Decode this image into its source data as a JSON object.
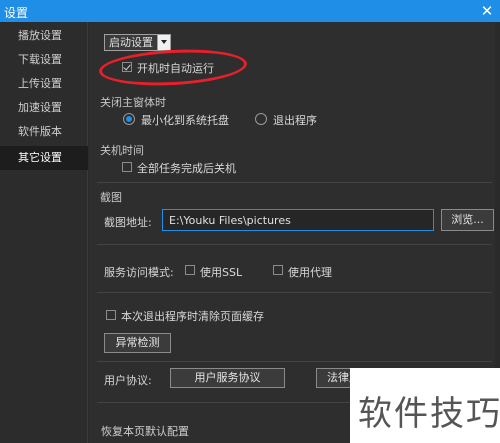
{
  "window": {
    "title": "设置",
    "close_icon": "close-icon"
  },
  "sidebar": {
    "items": [
      {
        "label": "播放设置",
        "active": false
      },
      {
        "label": "下载设置",
        "active": false
      },
      {
        "label": "上传设置",
        "active": false
      },
      {
        "label": "加速设置",
        "active": false
      },
      {
        "label": "软件版本",
        "active": false
      },
      {
        "label": "其它设置",
        "active": true
      }
    ]
  },
  "startup": {
    "dropdown_label": "启动设置",
    "autorun_label": "开机时自动运行",
    "autorun_checked": true
  },
  "close_main": {
    "section": "关闭主窗体时",
    "option_minimize": "最小化到系统托盘",
    "option_exit": "退出程序",
    "selected": "minimize"
  },
  "shutdown": {
    "section": "关机时间",
    "after_tasks_label": "全部任务完成后关机",
    "after_tasks_checked": false
  },
  "screenshot": {
    "section": "截图",
    "path_label": "截图地址:",
    "path_value": "E:\\Youku Files\\pictures",
    "browse_label": "浏览..."
  },
  "service": {
    "mode_label": "服务访问模式:",
    "use_ssl_label": "使用SSL",
    "use_proxy_label": "使用代理",
    "use_ssl_checked": false,
    "use_proxy_checked": false
  },
  "cache": {
    "clear_label": "本次退出程序时清除页面缓存",
    "clear_checked": false,
    "detect_button": "异常检测"
  },
  "agreement": {
    "label": "用户协议:",
    "service_button": "用户服务协议",
    "law_button": "法律声"
  },
  "footer": {
    "restore_label": "恢复本页默认配置"
  },
  "watermark": {
    "text": "软件技巧"
  },
  "colors": {
    "accent": "#1e8ee6",
    "highlight_ring": "#e8202a"
  }
}
